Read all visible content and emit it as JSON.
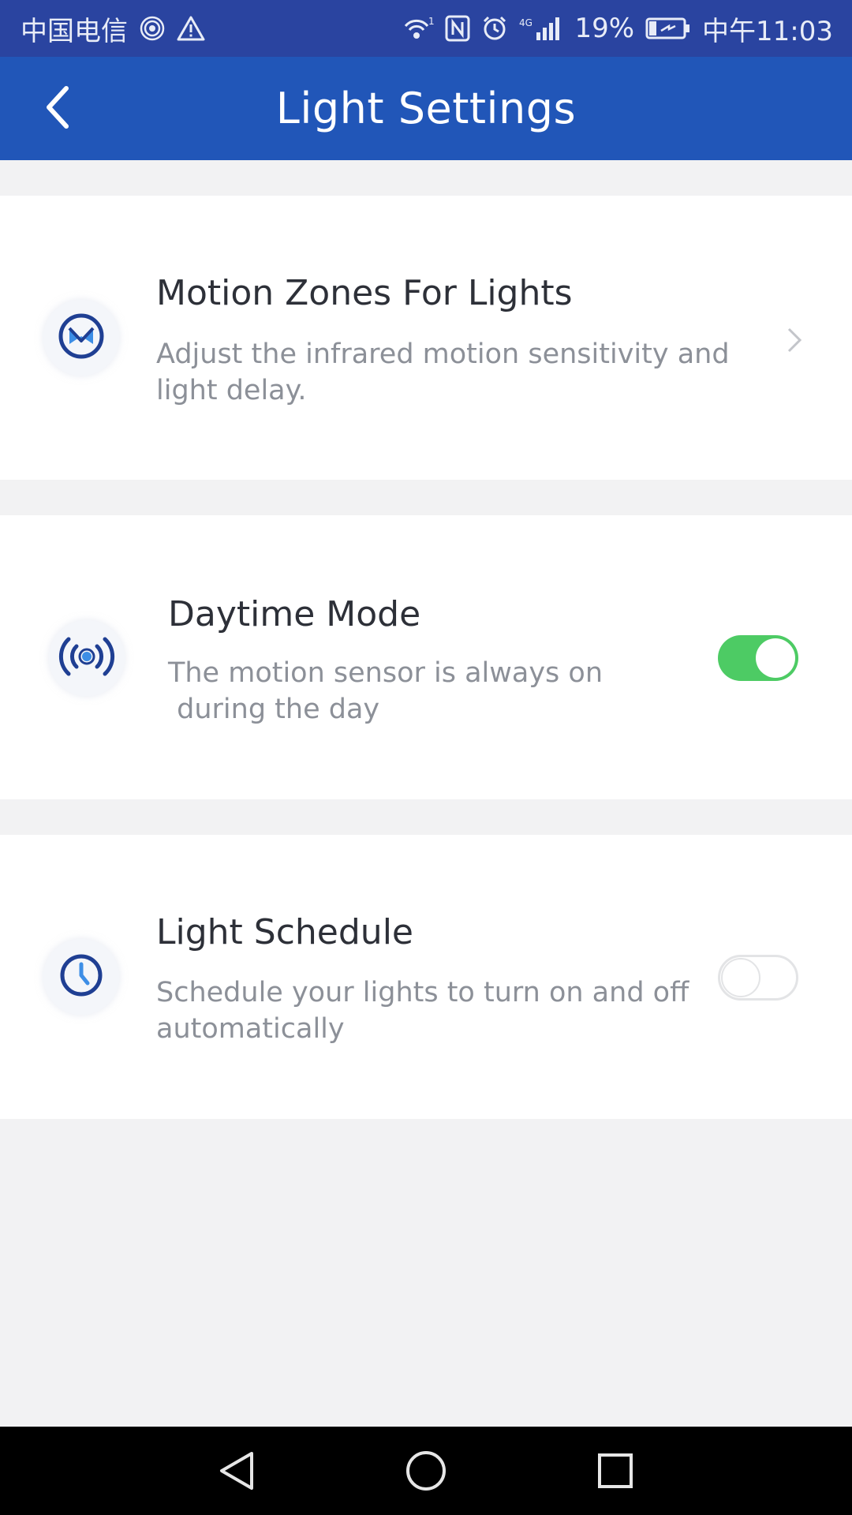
{
  "status_bar": {
    "carrier": "中国电信",
    "signal_label": "4G",
    "battery": "19%",
    "time": "中午11:03",
    "icons": [
      "hotspot-icon",
      "warning-icon",
      "wifi-icon",
      "nfc-icon",
      "alarm-icon",
      "signal-icon",
      "battery-icon"
    ]
  },
  "header": {
    "title": "Light Settings",
    "back_icon": "back-arrow-icon"
  },
  "settings": {
    "motion_zones": {
      "title": "Motion Zones For Lights",
      "description": "Adjust the infrared motion sensitivity and light delay.",
      "icon": "motion-zone-icon",
      "action_icon": "chevron-right-icon"
    },
    "daytime_mode": {
      "title": "Daytime Mode",
      "description_line1": "The motion sensor is always on",
      "description_line2": " during the day",
      "icon": "broadcast-sensor-icon",
      "enabled": true
    },
    "light_schedule": {
      "title": "Light Schedule",
      "description": "Schedule your lights to turn on and off automatically",
      "icon": "clock-icon",
      "enabled": false
    }
  },
  "colors": {
    "status_bar": "#2a44a0",
    "header": "#2156b8",
    "toggle_on": "#4dcb64",
    "icon_accent": "#1f3f93",
    "icon_light": "#3d8ee6"
  },
  "nav_bar": {
    "icons": [
      "nav-back-icon",
      "nav-home-icon",
      "nav-recents-icon"
    ]
  }
}
